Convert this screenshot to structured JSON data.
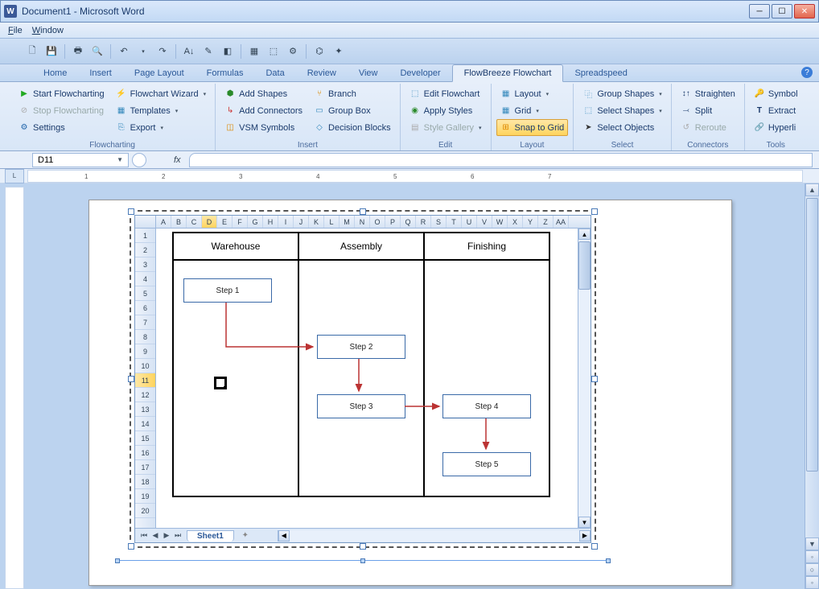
{
  "titlebar": {
    "title": "Document1 - Microsoft Word",
    "app_icon_letter": "W"
  },
  "menubar": {
    "file": "File",
    "window": "Window"
  },
  "ribbon_tabs": [
    "Home",
    "Insert",
    "Page Layout",
    "Formulas",
    "Data",
    "Review",
    "View",
    "Developer",
    "FlowBreeze Flowchart",
    "Spreadspeed"
  ],
  "active_tab_index": 8,
  "ribbon": {
    "flowcharting": {
      "label": "Flowcharting",
      "start": "Start Flowcharting",
      "stop": "Stop Flowcharting",
      "settings": "Settings",
      "wizard": "Flowchart Wizard",
      "templates": "Templates",
      "export": "Export"
    },
    "insert": {
      "label": "Insert",
      "add_shapes": "Add Shapes",
      "add_connectors": "Add Connectors",
      "vsm_symbols": "VSM Symbols",
      "branch": "Branch",
      "group_box": "Group Box",
      "decision_blocks": "Decision Blocks"
    },
    "edit": {
      "label": "Edit",
      "edit_flowchart": "Edit Flowchart",
      "apply_styles": "Apply Styles",
      "style_gallery": "Style Gallery"
    },
    "layout": {
      "label": "Layout",
      "layout": "Layout",
      "grid": "Grid",
      "snap": "Snap to Grid"
    },
    "select": {
      "label": "Select",
      "group_shapes": "Group Shapes",
      "select_shapes": "Select Shapes",
      "select_objects": "Select Objects"
    },
    "connectors": {
      "label": "Connectors",
      "straighten": "Straighten",
      "split": "Split",
      "reroute": "Reroute"
    },
    "tools": {
      "label": "Tools",
      "symbol": "Symbol",
      "extract": "Extract",
      "hyperlink": "Hyperli"
    }
  },
  "namebox": {
    "value": "D11",
    "fx": "fx"
  },
  "ruler_numbers": [
    "1",
    "2",
    "3",
    "4",
    "5",
    "6",
    "7"
  ],
  "sheet": {
    "columns": [
      "A",
      "B",
      "C",
      "D",
      "E",
      "F",
      "G",
      "H",
      "I",
      "J",
      "K",
      "L",
      "M",
      "N",
      "O",
      "P",
      "Q",
      "R",
      "S",
      "T",
      "U",
      "V",
      "W",
      "X",
      "Y",
      "Z",
      "AA"
    ],
    "selected_col": "D",
    "rows": [
      "1",
      "2",
      "3",
      "4",
      "5",
      "6",
      "7",
      "8",
      "9",
      "10",
      "11",
      "12",
      "13",
      "14",
      "15",
      "16",
      "17",
      "18",
      "19",
      "20"
    ],
    "selected_row": "11",
    "tab": "Sheet1"
  },
  "swimlanes": {
    "headers": [
      "Warehouse",
      "Assembly",
      "Finishing"
    ],
    "steps": {
      "s1": "Step 1",
      "s2": "Step 2",
      "s3": "Step 3",
      "s4": "Step 4",
      "s5": "Step 5"
    }
  }
}
